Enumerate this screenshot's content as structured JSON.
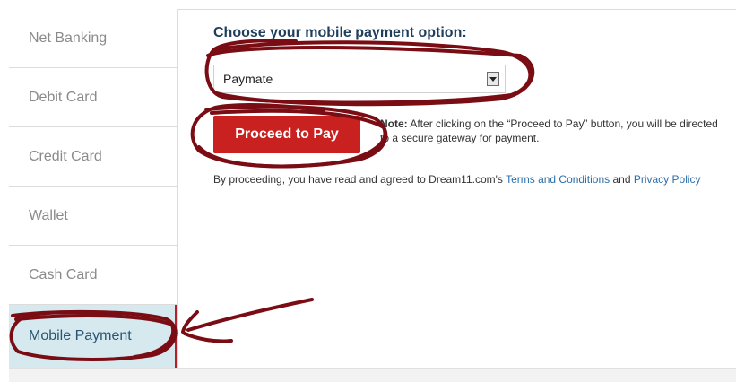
{
  "sidebar": {
    "items": [
      {
        "label": "Net Banking"
      },
      {
        "label": "Debit Card"
      },
      {
        "label": "Credit Card"
      },
      {
        "label": "Wallet"
      },
      {
        "label": "Cash Card"
      },
      {
        "label": "Mobile Payment"
      }
    ],
    "active_index": 5
  },
  "main": {
    "heading": "Choose your mobile payment option:",
    "select": {
      "value": "Paymate",
      "arrow_icon": "dropdown-arrow-icon"
    },
    "pay_button_label": "Proceed to Pay",
    "note": {
      "label": "Note:",
      "text": "After clicking on the “Proceed to Pay” button, you will be directed to a secure gateway for payment."
    },
    "agreement": {
      "prefix": "By proceeding, you have read and agreed to Dream11.com's",
      "terms_link": "Terms and Conditions",
      "joiner": "and",
      "privacy_link": "Privacy Policy"
    }
  },
  "colors": {
    "accent_red": "#c8211f",
    "active_tab_bg": "#d6e9ef",
    "heading": "#1e3e5c",
    "link": "#2a6ea8",
    "annotation": "#7a0c14"
  }
}
